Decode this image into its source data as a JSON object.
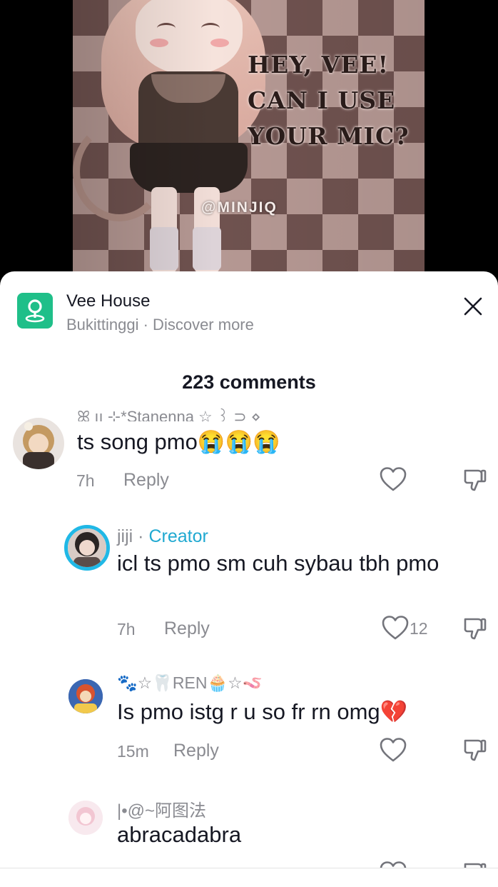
{
  "video": {
    "caption": "HEY, VEE!\nCAN I USE\nYOUR MIC?",
    "watermark": "@MINJIQ"
  },
  "place": {
    "title": "Vee House",
    "subtitle": "Bukittinggi · Discover more",
    "icon": "location-pin-icon",
    "accent": "#1fbf89"
  },
  "comments_header": "223 comments",
  "comments": [
    {
      "username": "ꕤ ıı ⊹*Stanenna ☆ ꒱ ⊃ ⋄",
      "text": "ts song pmo😭😭😭",
      "time": "7h",
      "reply_label": "Reply"
    },
    {
      "username": "jiji",
      "creator_label": "Creator",
      "separator": "·",
      "text": "icl ts pmo sm cuh sybau tbh pmo",
      "time": "7h",
      "reply_label": "Reply",
      "likes": "12"
    },
    {
      "username": "🐾☆🦷REN🧁☆🪱",
      "text": "Is pmo istg r u so fr rn omg💔",
      "time": "15m",
      "reply_label": "Reply"
    },
    {
      "username": "|•@~阿图法",
      "text": "abracadabra",
      "time": "",
      "reply_label": ""
    }
  ],
  "colors": {
    "text": "#161823",
    "muted": "#8a8b91",
    "creator": "#20a9d1",
    "creator_ring": "#20b8e6"
  }
}
